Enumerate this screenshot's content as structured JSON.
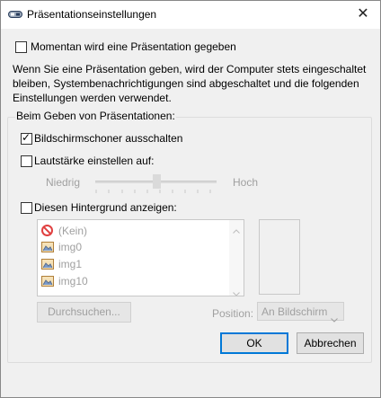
{
  "window": {
    "title": "Präsentationseinstellungen",
    "close_glyph": "✕"
  },
  "presenting_now": {
    "label": "Momentan wird eine Präsentation gegeben",
    "checked": false
  },
  "description": "Wenn Sie eine Präsentation geben, wird der Computer stets eingeschaltet bleiben, Systembenachrichtigungen sind abgeschaltet und die folgenden Einstellungen werden verwendet.",
  "group": {
    "title": "Beim Geben von Präsentationen:",
    "screensaver": {
      "label": "Bildschirmschoner ausschalten",
      "checked": true
    },
    "volume": {
      "label": "Lautstärke einstellen auf:",
      "checked": false,
      "low": "Niedrig",
      "high": "Hoch",
      "level": 0.5
    },
    "background": {
      "label": "Diesen Hintergrund anzeigen:",
      "checked": false,
      "items": [
        {
          "label": "(Kein)",
          "icon": "no-entry-icon"
        },
        {
          "label": "img0",
          "icon": "image-icon"
        },
        {
          "label": "img1",
          "icon": "image-icon"
        },
        {
          "label": "img10",
          "icon": "image-icon"
        }
      ],
      "browse_label": "Durchsuchen...",
      "position_label": "Position:",
      "position_value": "An Bildschirm"
    }
  },
  "buttons": {
    "ok": "OK",
    "cancel": "Abbrechen"
  }
}
